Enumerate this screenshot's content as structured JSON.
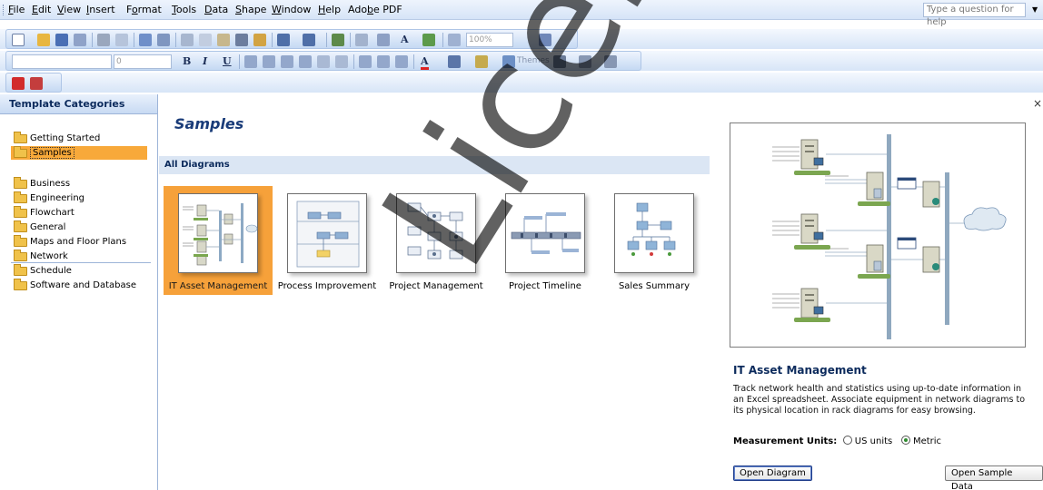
{
  "menu": {
    "items": [
      {
        "label": "File",
        "ul": "F"
      },
      {
        "label": "Edit",
        "ul": "E"
      },
      {
        "label": "View",
        "ul": "V"
      },
      {
        "label": "Insert",
        "ul": "I"
      },
      {
        "label": "Format",
        "ul": "o"
      },
      {
        "label": "Tools",
        "ul": "T"
      },
      {
        "label": "Data",
        "ul": "D"
      },
      {
        "label": "Shape",
        "ul": "S"
      },
      {
        "label": "Window",
        "ul": "W"
      },
      {
        "label": "Help",
        "ul": "H"
      },
      {
        "label": "Adobe PDF",
        "ul": "b"
      }
    ],
    "help_placeholder": "Type a question for help"
  },
  "toolbar": {
    "zoom": "100%",
    "font_size": "0",
    "themes_label": "Themes",
    "bold": "B",
    "italic": "I",
    "underline": "U",
    "text_color": "A"
  },
  "left": {
    "header": "Template Categories",
    "top_items": [
      "Getting Started",
      "Samples"
    ],
    "selected": "Samples",
    "categories": [
      "Business",
      "Engineering",
      "Flowchart",
      "General",
      "Maps and Floor Plans",
      "Network",
      "Schedule",
      "Software and Database"
    ]
  },
  "center": {
    "title": "Samples",
    "section": "All Diagrams",
    "tiles": [
      {
        "label": "IT Asset Management",
        "selected": true
      },
      {
        "label": "Process Improvement",
        "selected": false
      },
      {
        "label": "Project Management",
        "selected": false
      },
      {
        "label": "Project Timeline",
        "selected": false
      },
      {
        "label": "Sales Summary",
        "selected": false
      }
    ]
  },
  "right": {
    "close": "×",
    "title": "IT Asset Management",
    "description": "Track network health and statistics using up-to-date information in an Excel spreadsheet. Associate equipment in network diagrams to its physical location in rack diagrams for easy browsing.",
    "units_label": "Measurement Units:",
    "unit_options": [
      "US units",
      "Metric"
    ],
    "selected_unit": "Metric",
    "open_button": "Open Diagram",
    "sample_button": "Open Sample Data"
  },
  "watermark": "Licensed Quality"
}
